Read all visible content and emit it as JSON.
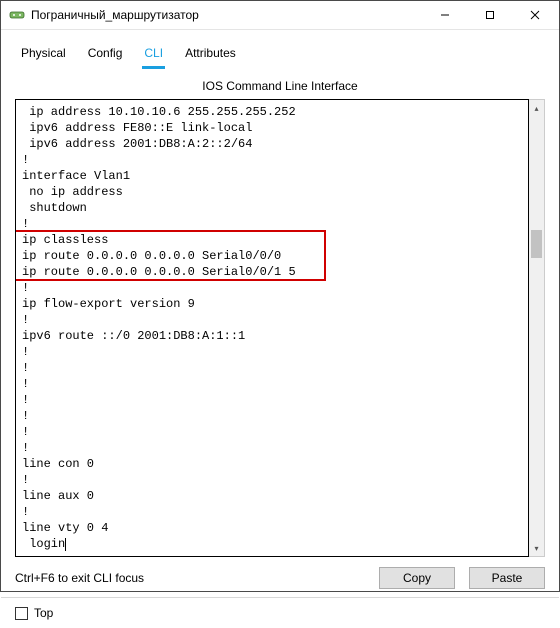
{
  "window": {
    "title": "Пограничный_маршрутизатор"
  },
  "tabs": {
    "physical": "Physical",
    "config": "Config",
    "cli": "CLI",
    "attributes": "Attributes",
    "active": "cli"
  },
  "cli": {
    "heading": "IOS Command Line Interface",
    "lines": [
      " ip address 10.10.10.6 255.255.255.252",
      " ipv6 address FE80::E link-local",
      " ipv6 address 2001:DB8:A:2::2/64",
      "!",
      "interface Vlan1",
      " no ip address",
      " shutdown",
      "!",
      "ip classless",
      "ip route 0.0.0.0 0.0.0.0 Serial0/0/0 ",
      "ip route 0.0.0.0 0.0.0.0 Serial0/0/1 5 ",
      "!",
      "ip flow-export version 9",
      "!",
      "ipv6 route ::/0 2001:DB8:A:1::1",
      "!",
      "!",
      "!",
      "!",
      "!",
      "!",
      "!",
      "line con 0",
      "!",
      "line aux 0",
      "!",
      "line vty 0 4",
      " login"
    ],
    "highlight": {
      "startLine": 8,
      "endLine": 10
    }
  },
  "buttons": {
    "hint": "Ctrl+F6 to exit CLI focus",
    "copy": "Copy",
    "paste": "Paste"
  },
  "footer": {
    "top_label": "Top",
    "top_checked": false
  }
}
